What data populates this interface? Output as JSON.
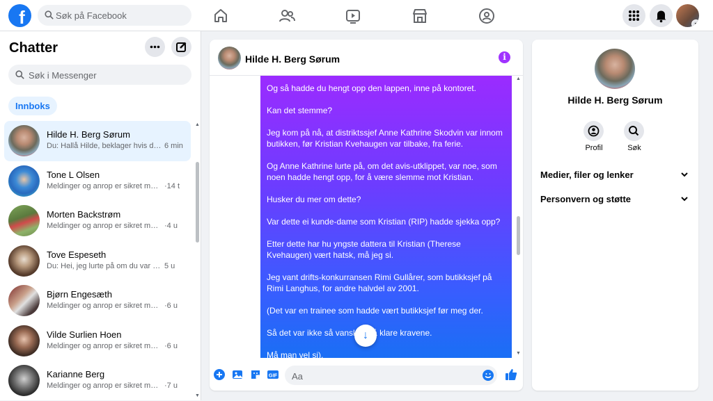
{
  "header": {
    "logo_letter": "f",
    "search_placeholder": "Søk på Facebook"
  },
  "sidebar": {
    "title": "Chatter",
    "search_placeholder": "Søk i Messenger",
    "filter_label": "Innboks",
    "conversations": [
      {
        "name": "Hilde H. Berg Sørum",
        "preview": "Du: Hallå Hilde, beklager hvis det...",
        "time": "6 min"
      },
      {
        "name": "Tone L Olsen",
        "preview": "Meldinger og anrop er sikret med ...",
        "time": "·14 t"
      },
      {
        "name": "Morten Backstrøm",
        "preview": "Meldinger og anrop er sikret med e...",
        "time": "·4 u"
      },
      {
        "name": "Tove Espeseth",
        "preview": "Du: Hei, jeg lurte på om du var med...",
        "time": "5 u"
      },
      {
        "name": "Bjørn Engesæth",
        "preview": "Meldinger og anrop er sikret med e...",
        "time": "·6 u"
      },
      {
        "name": "Vilde Surlien Hoen",
        "preview": "Meldinger og anrop er sikret med e...",
        "time": "·6 u"
      },
      {
        "name": "Karianne Berg",
        "preview": "Meldinger og anrop er sikret med e...",
        "time": "·7 u"
      }
    ]
  },
  "chat": {
    "contact_name": "Hilde H. Berg Sørum",
    "info_glyph": "i",
    "message_paragraphs": [
      "Og så hadde du hengt opp den lappen, inne på kontoret.",
      "Kan det stemme?",
      "Jeg kom på nå, at distriktssjef Anne Kathrine Skodvin var innom butikken, før Kristian Kvehaugen var tilbake, fra ferie.",
      "Og Anne Kathrine lurte på, om det avis-utklippet, var noe, som noen hadde hengt opp, for å være slemme mot Kristian.",
      "Husker du mer om dette?",
      "Var dette ei kunde-dame som Kristian (RIP) hadde sjekka opp?",
      "Etter dette har hu yngste dattera til Kristian (Therese Kvehaugen) vært hatsk, må jeg si.",
      "Jeg vant drifts-konkurransen Rimi Gullårer, som butikksjef på Rimi Langhus, for andre halvdel av 2001.",
      "(Det var en trainee som hadde vært butikksjef før meg der.",
      "Så det var ikke så vanskelig å klare kravene.",
      "Må man vel si)."
    ],
    "composer_placeholder": "Aa",
    "scroll_down_glyph": "↓"
  },
  "profile_panel": {
    "name": "Hilde H. Berg Sørum",
    "actions": [
      {
        "label": "Profil",
        "icon": "profile-icon"
      },
      {
        "label": "Søk",
        "icon": "search-icon"
      }
    ],
    "sections": [
      {
        "label": "Medier, filer og lenker"
      },
      {
        "label": "Personvern og støtte"
      }
    ]
  },
  "colors": {
    "brand": "#1877f2",
    "bubble_top": "#9b2bff",
    "bubble_bottom": "#1a6ff5",
    "info_purple": "#a033ff"
  }
}
